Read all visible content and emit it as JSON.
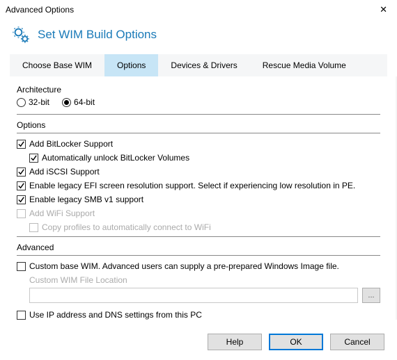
{
  "window": {
    "title": "Advanced Options"
  },
  "header": {
    "title": "Set WIM Build Options"
  },
  "tabs": {
    "base": "Choose Base WIM",
    "options": "Options",
    "devices": "Devices & Drivers",
    "rescue": "Rescue Media Volume"
  },
  "arch": {
    "label": "Architecture",
    "r32": "32-bit",
    "r64": "64-bit"
  },
  "options": {
    "label": "Options",
    "bitlocker": "Add BitLocker Support",
    "bitlocker_auto": "Automatically unlock BitLocker Volumes",
    "iscsi": "Add iSCSI Support",
    "efi": "Enable legacy EFI screen resolution support. Select if experiencing low resolution in PE.",
    "smb": "Enable legacy SMB v1 support",
    "wifi": "Add WiFi Support",
    "wifi_copy": "Copy profiles to automatically connect to WiFi"
  },
  "advanced": {
    "label": "Advanced",
    "custom_wim": "Custom base WIM. Advanced users can supply a pre-prepared Windows Image file.",
    "wim_location_label": "Custom WIM File Location",
    "browse": "...",
    "use_ip": "Use IP address and DNS settings from this PC"
  },
  "buttons": {
    "help": "Help",
    "ok": "OK",
    "cancel": "Cancel"
  }
}
